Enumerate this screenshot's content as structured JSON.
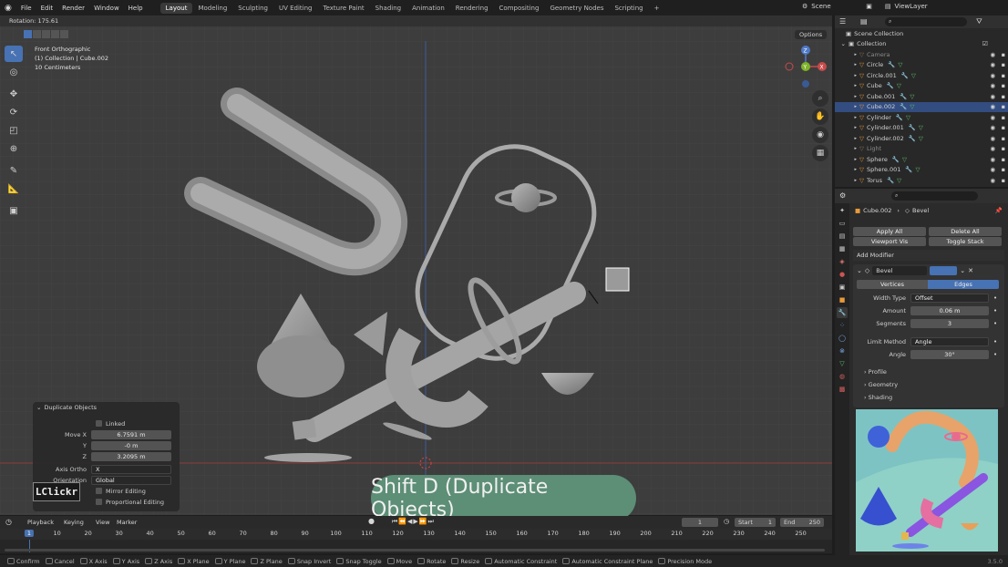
{
  "menu": [
    "File",
    "Edit",
    "Render",
    "Window",
    "Help"
  ],
  "workspaces": [
    "Layout",
    "Modeling",
    "Sculpting",
    "UV Editing",
    "Texture Paint",
    "Shading",
    "Animation",
    "Rendering",
    "Compositing",
    "Geometry Nodes",
    "Scripting"
  ],
  "active_workspace": "Layout",
  "scene": "Scene",
  "view_layer": "ViewLayer",
  "viewport": {
    "rotation_text": "Rotation: 175.61",
    "view_name": "Front Orthographic",
    "collection_info": "(1) Collection | Cube.002",
    "scale_info": "10 Centimeters",
    "options_label": "Options",
    "gizmo": {
      "z": "Z",
      "y": "Y",
      "x": "X"
    }
  },
  "operator_panel": {
    "title": "Duplicate Objects",
    "linked_label": "Linked",
    "move_x_label": "Move X",
    "move_x": "6.7591 m",
    "y_label": "Y",
    "move_y": "-0 m",
    "z_label": "Z",
    "move_z": "3.2095 m",
    "axis_ortho_label": "Axis Ortho",
    "axis_ortho": "X",
    "orientation_label": "Orientation",
    "orientation": "Global",
    "mirror_label": "Mirror Editing",
    "proportional_label": "Proportional Editing"
  },
  "overlay_pill": "Shift D (Duplicate Objects)",
  "logo": "LClickr",
  "timeline": {
    "menu": [
      "Playback",
      "Keying",
      "View",
      "Marker"
    ],
    "current_frame": "1",
    "start_label": "Start",
    "start": "1",
    "end_label": "End",
    "end": "250",
    "ticks": [
      "1",
      "10",
      "20",
      "30",
      "40",
      "50",
      "60",
      "70",
      "80",
      "90",
      "100",
      "110",
      "120",
      "130",
      "140",
      "150",
      "160",
      "170",
      "180",
      "190",
      "200",
      "210",
      "220",
      "230",
      "240",
      "250"
    ]
  },
  "statusbar": [
    "Confirm",
    "Cancel",
    "X Axis",
    "Y Axis",
    "Z Axis",
    "X Plane",
    "Y Plane",
    "Z Plane",
    "Snap Invert",
    "Snap Toggle",
    "Move",
    "Rotate",
    "Resize",
    "Automatic Constraint",
    "Automatic Constraint Plane",
    "Precision Mode"
  ],
  "version": "3.5.0",
  "outliner": {
    "root": "Scene Collection",
    "collection": "Collection",
    "items": [
      {
        "name": "Camera",
        "dim": true,
        "sel": false
      },
      {
        "name": "Circle",
        "dim": false,
        "sel": false
      },
      {
        "name": "Circle.001",
        "dim": false,
        "sel": false
      },
      {
        "name": "Cube",
        "dim": false,
        "sel": false
      },
      {
        "name": "Cube.001",
        "dim": false,
        "sel": false
      },
      {
        "name": "Cube.002",
        "dim": false,
        "sel": true
      },
      {
        "name": "Cylinder",
        "dim": false,
        "sel": false
      },
      {
        "name": "Cylinder.001",
        "dim": false,
        "sel": false
      },
      {
        "name": "Cylinder.002",
        "dim": false,
        "sel": false
      },
      {
        "name": "Light",
        "dim": true,
        "sel": false
      },
      {
        "name": "Sphere",
        "dim": false,
        "sel": false
      },
      {
        "name": "Sphere.001",
        "dim": false,
        "sel": false
      },
      {
        "name": "Torus",
        "dim": false,
        "sel": false
      }
    ]
  },
  "properties": {
    "object": "Cube.002",
    "modifier_crumb": "Bevel",
    "apply_all": "Apply All",
    "delete_all": "Delete All",
    "viewport_vis": "Viewport Vis",
    "toggle_stack": "Toggle Stack",
    "add_modifier": "Add Modifier",
    "modifier_name": "Bevel",
    "tab_vertices": "Vertices",
    "tab_edges": "Edges",
    "width_type_label": "Width Type",
    "width_type": "Offset",
    "amount_label": "Amount",
    "amount": "0.06 m",
    "segments_label": "Segments",
    "segments": "3",
    "limit_method_label": "Limit Method",
    "limit_method": "Angle",
    "angle_label": "Angle",
    "angle": "30°",
    "sections": [
      "Profile",
      "Geometry",
      "Shading"
    ]
  },
  "colors": {
    "accent": "#4772b3",
    "pill": "#5d8e76",
    "selected_row": "#334d80"
  }
}
